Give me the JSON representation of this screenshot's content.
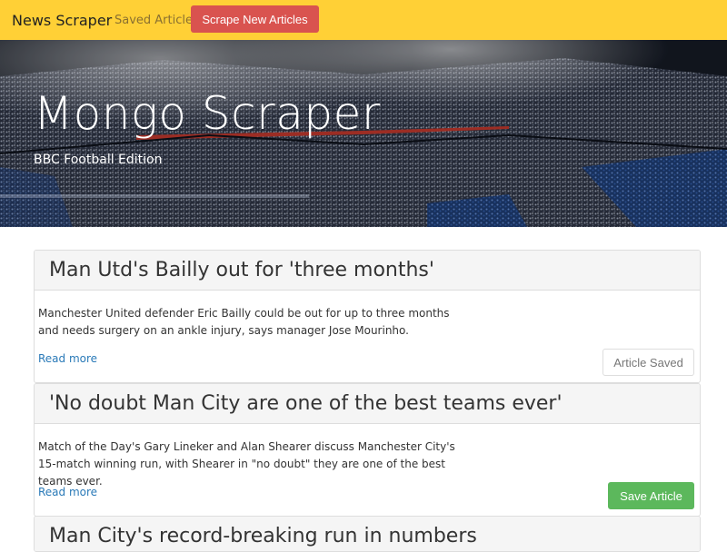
{
  "navbar": {
    "brand": "News Scraper",
    "saved_link": "Saved Articles",
    "scrape_button": "Scrape New Articles",
    "bar_color": "#ffd036",
    "scrape_color": "#d9534f"
  },
  "hero": {
    "title": "Mongo Scraper",
    "subtitle": "BBC Football Edition"
  },
  "articles": [
    {
      "title": "Man Utd's Bailly out for 'three months'",
      "summary": "Manchester United defender Eric Bailly could be out for up to three months and needs surgery on an ankle injury, says manager Jose Mourinho.",
      "link_text": "Read more",
      "button": "Article Saved"
    },
    {
      "title": "'No doubt Man City are one of the best teams ever'",
      "summary": "Match of the Day's Gary Lineker and Alan Shearer discuss Manchester City's 15-match winning run, with Shearer in \"no doubt\" they are one of the best teams ever.",
      "link_text": "Read more",
      "button": "Save Article"
    },
    {
      "title": "Man City's record-breaking run in numbers"
    }
  ]
}
